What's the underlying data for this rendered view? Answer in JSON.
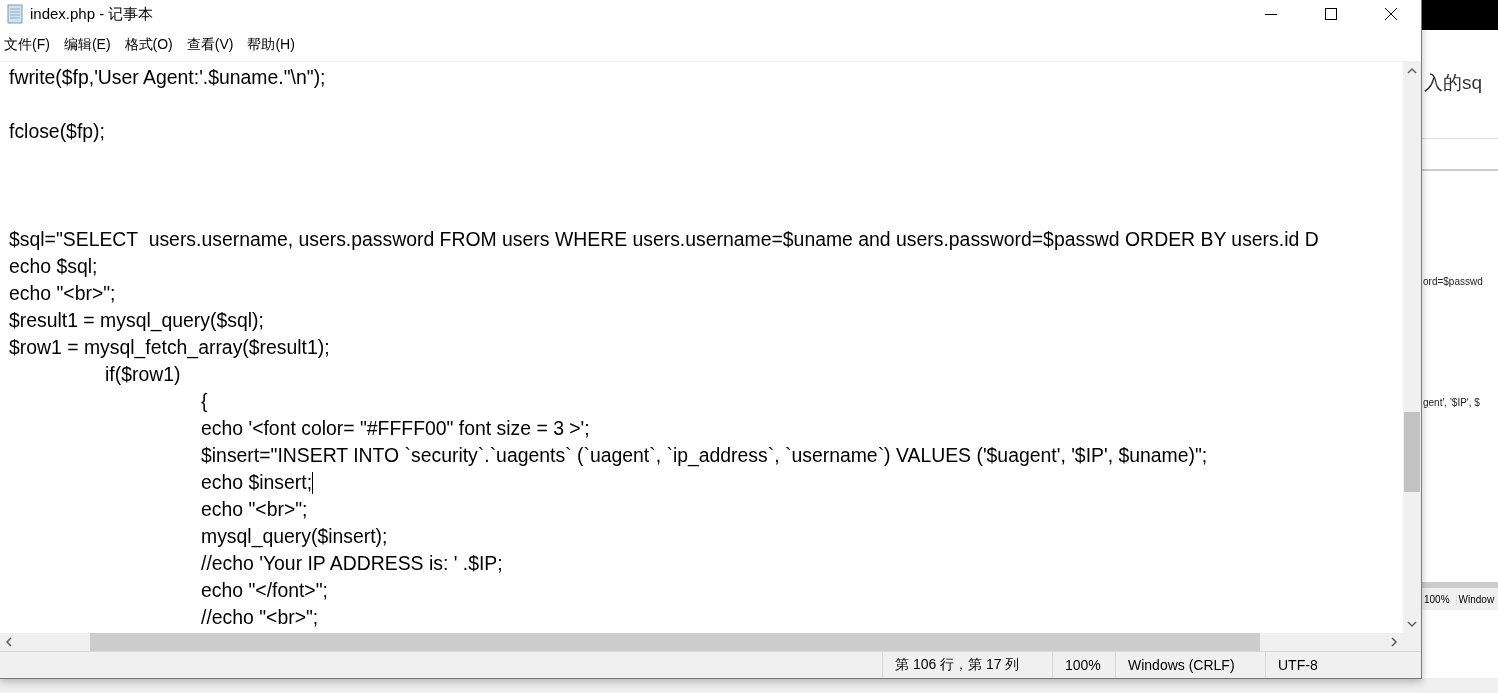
{
  "window": {
    "title": "index.php - 记事本"
  },
  "menu": [
    "文件(F)",
    "编辑(E)",
    "格式(O)",
    "查看(V)",
    "帮助(H)"
  ],
  "lines": [
    {
      "kind": "code",
      "text": "fwrite($fp,'User Agent:'.$uname.\"\\n\");"
    },
    {
      "kind": "blank"
    },
    {
      "kind": "code",
      "text": "fclose($fp);"
    },
    {
      "kind": "blank"
    },
    {
      "kind": "blank"
    },
    {
      "kind": "blank"
    },
    {
      "kind": "code",
      "text": "$sql=\"SELECT  users.username, users.password FROM users WHERE users.username=$uname and users.password=$passwd ORDER BY users.id D"
    },
    {
      "kind": "code",
      "text": "echo $sql;"
    },
    {
      "kind": "code",
      "text": "echo \"<br>\";"
    },
    {
      "kind": "code",
      "text": "$result1 = mysql_query($sql);"
    },
    {
      "kind": "code",
      "text": "$row1 = mysql_fetch_array($result1);"
    },
    {
      "kind": "code",
      "text": "\tif($row1)"
    },
    {
      "kind": "code",
      "text": "\t\t{"
    },
    {
      "kind": "code",
      "text": "\t\techo '<font color= \"#FFFF00\" font size = 3 >';"
    },
    {
      "kind": "code",
      "text": "\t\t$insert=\"INSERT INTO `security`.`uagents` (`uagent`, `ip_address`, `username`) VALUES ('$uagent', '$IP', $uname)\";"
    },
    {
      "kind": "code",
      "text": "\t\techo $insert;",
      "caret": true
    },
    {
      "kind": "code",
      "text": "\t\techo \"<br>\";"
    },
    {
      "kind": "code",
      "text": "\t\tmysql_query($insert);"
    },
    {
      "kind": "code",
      "text": "\t\t//echo 'Your IP ADDRESS is: ' .$IP;"
    },
    {
      "kind": "code",
      "text": "\t\techo \"</font>\";"
    },
    {
      "kind": "code",
      "text": "\t\t//echo \"<br>\";"
    }
  ],
  "status_bar": [
    "第 106 行，第 17 列",
    "100%",
    "Windows (CRLF)",
    "UTF-8"
  ],
  "background_window": {
    "heading": "入的sq",
    "texts": [
      "ord=$passwd",
      "gent', '$IP', $"
    ],
    "status": [
      "100%",
      "Window"
    ]
  }
}
